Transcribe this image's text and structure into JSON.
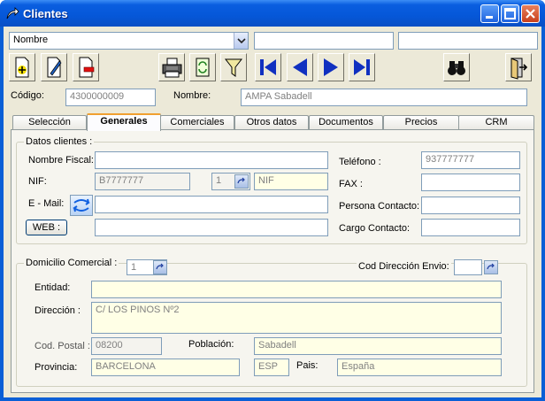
{
  "window": {
    "title": "Clientes"
  },
  "search": {
    "field_select": "Nombre",
    "value1": "",
    "value2": ""
  },
  "header": {
    "codigo_label": "Código:",
    "codigo_value": "4300000009",
    "nombre_label": "Nombre:",
    "nombre_value": "AMPA Sabadell"
  },
  "tabs": [
    {
      "label": "Selección"
    },
    {
      "label": "Generales"
    },
    {
      "label": "Comerciales"
    },
    {
      "label": "Otros datos"
    },
    {
      "label": "Documentos"
    },
    {
      "label": "Precios"
    },
    {
      "label": "CRM"
    }
  ],
  "datos": {
    "group_title": "Datos clientes :",
    "nombre_fiscal_label": "Nombre Fiscal:",
    "nombre_fiscal_value": "",
    "nif_label": "NIF:",
    "nif_value": "B7777777",
    "nif_type_num": "1",
    "nif_type": "NIF",
    "email_label": "E - Mail:",
    "email_value": "",
    "web_button": "WEB :",
    "web_value": "",
    "telefono_label": "Teléfono :",
    "telefono_value": "937777777",
    "fax_label": "FAX :",
    "fax_value": "",
    "persona_label": "Persona Contacto:",
    "persona_value": "",
    "cargo_label": "Cargo Contacto:",
    "cargo_value": ""
  },
  "domicilio": {
    "group_title": "Domicilio Comercial :",
    "domicilio_num": "1",
    "envio_label": "Cod Dirección Envio:",
    "envio_value": "",
    "entidad_label": "Entidad:",
    "entidad_value": "",
    "direccion_label": "Dirección :",
    "direccion_value": "C/ LOS PINOS Nº2",
    "cp_label": "Cod. Postal :",
    "cp_value": "08200",
    "poblacion_label": "Población:",
    "poblacion_value": "Sabadell",
    "provincia_label": "Provincia:",
    "provincia_value": "BARCELONA",
    "pais_code": "ESP",
    "pais_label": "Pais:",
    "pais_value": "España"
  }
}
